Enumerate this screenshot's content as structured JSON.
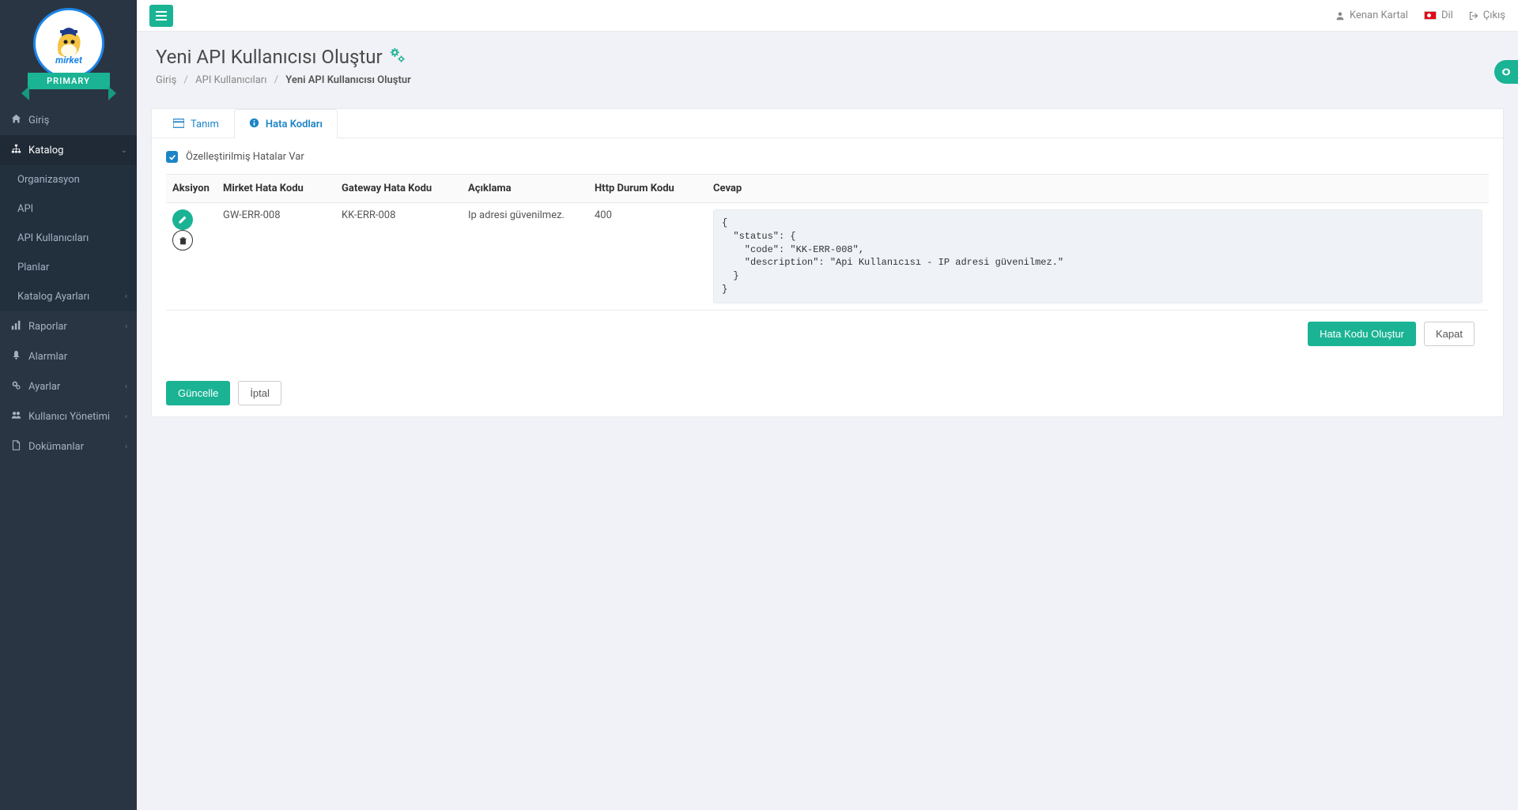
{
  "header": {
    "user_name": "Kenan Kartal",
    "language_label": "Dil",
    "logout_label": "Çıkış"
  },
  "sidebar": {
    "ribbon_label": "PRIMARY",
    "items": [
      {
        "label": "Giriş",
        "icon": "home",
        "expandable": false
      },
      {
        "label": "Katalog",
        "icon": "sitemap",
        "expandable": true,
        "expanded": true,
        "children": [
          {
            "label": "Organizasyon"
          },
          {
            "label": "API"
          },
          {
            "label": "API Kullanıcıları"
          },
          {
            "label": "Planlar"
          },
          {
            "label": "Katalog Ayarları",
            "expandable": true
          }
        ]
      },
      {
        "label": "Raporlar",
        "icon": "chart",
        "expandable": true
      },
      {
        "label": "Alarmlar",
        "icon": "bell",
        "expandable": false
      },
      {
        "label": "Ayarlar",
        "icon": "cogs",
        "expandable": true
      },
      {
        "label": "Kullanıcı Yönetimi",
        "icon": "users",
        "expandable": true
      },
      {
        "label": "Dokümanlar",
        "icon": "file",
        "expandable": true
      }
    ]
  },
  "page": {
    "title": "Yeni API Kullanıcısı Oluştur",
    "breadcrumb": {
      "root": "Giriş",
      "mid": "API Kullanıcıları",
      "active": "Yeni API Kullanıcısı Oluştur"
    }
  },
  "tabs": {
    "definition": "Tanım",
    "error_codes": "Hata Kodları"
  },
  "error_panel": {
    "checkbox_label": "Özelleştirilmiş Hatalar Var",
    "checkbox_checked": true,
    "columns": {
      "action": "Aksiyon",
      "mirket_code": "Mirket Hata Kodu",
      "gateway_code": "Gateway Hata Kodu",
      "description": "Açıklama",
      "http_status": "Http Durum Kodu",
      "response": "Cevap"
    },
    "rows": [
      {
        "mirket_code": "GW-ERR-008",
        "gateway_code": "KK-ERR-008",
        "description": "Ip adresi güvenilmez.",
        "http_status": "400",
        "response": "{\n  \"status\": {\n    \"code\": \"KK-ERR-008\",\n    \"description\": \"Api Kullanıcısı - IP adresi güvenilmez.\"\n  }\n}"
      }
    ],
    "create_button": "Hata Kodu Oluştur",
    "close_button": "Kapat"
  },
  "footer_buttons": {
    "update": "Güncelle",
    "cancel": "İptal"
  },
  "icons": {
    "home": "⌂",
    "sitemap": "⚍",
    "chart": "📊",
    "bell": "🔔",
    "cogs": "⚙",
    "users": "👥",
    "file": "🗎",
    "chevron_right": "›",
    "chevron_down": "⌄",
    "hamburger": "≡",
    "user": "👤",
    "logout": "↪",
    "gears": "⚙⚙",
    "card": "🗔",
    "info": "ⓘ",
    "check": "✓",
    "pencil": "✎",
    "trash": "🗑"
  }
}
